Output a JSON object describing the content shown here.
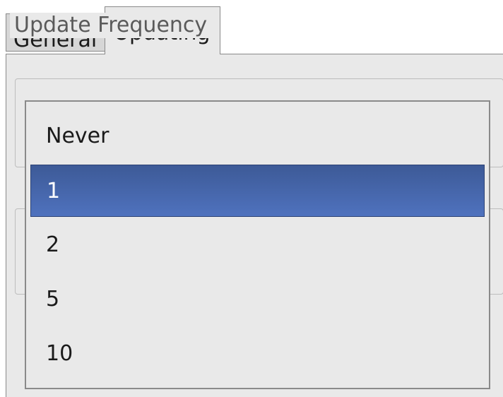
{
  "tabs": [
    {
      "label": "General",
      "active": false
    },
    {
      "label": "Updating",
      "active": true
    }
  ],
  "group_frequency": {
    "legend": "Update Frequency"
  },
  "dropdown": {
    "options": [
      "Never",
      "1",
      "2",
      "5",
      "10"
    ],
    "selected": "1"
  },
  "colors": {
    "selection": "#4563a8",
    "panel": "#e9e9e9",
    "inactive_tab": "#d6d6d6"
  }
}
